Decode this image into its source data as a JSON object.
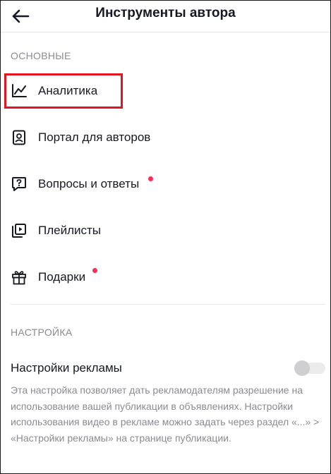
{
  "header": {
    "title": "Инструменты автора"
  },
  "sections": {
    "main_title": "ОСНОВНЫЕ",
    "settings_title": "НАСТРОЙКА"
  },
  "menu": [
    {
      "label": "Аналитика",
      "icon": "analytics-chart-icon",
      "new_dot": false,
      "highlighted": true
    },
    {
      "label": "Портал для авторов",
      "icon": "creator-portal-icon",
      "new_dot": false
    },
    {
      "label": "Вопросы и ответы",
      "icon": "question-bubble-icon",
      "new_dot": true
    },
    {
      "label": "Плейлисты",
      "icon": "playlist-icon",
      "new_dot": false
    },
    {
      "label": "Подарки",
      "icon": "gift-icon",
      "new_dot": true
    }
  ],
  "ads": {
    "label": "Настройки рекламы",
    "enabled": false,
    "description": "Эта настройка позволяет дать рекламодателям разрешение на использование вашей публикации в объявлениях. Настройки использования видео в рекламе можно задать через раздел «...» > «Настройки рекламы» на странице публикации."
  },
  "colors": {
    "accent_dot": "#fe2c55",
    "highlight_box": "#e4141e",
    "muted_text": "#8a8b91"
  }
}
